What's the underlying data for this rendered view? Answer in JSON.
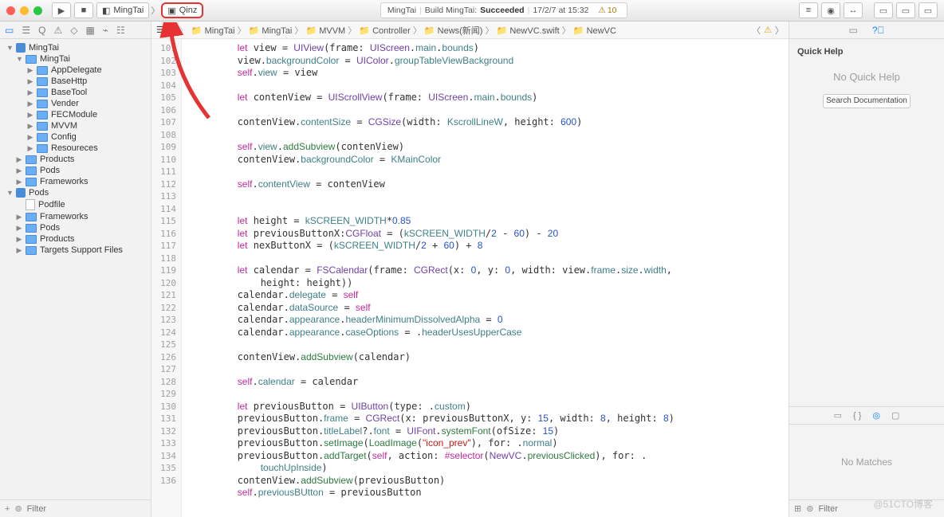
{
  "toolbar": {
    "scheme_app": "MingTai",
    "scheme_device": "Qinz",
    "status_prefix": "MingTai",
    "status_text": "Build MingTai:",
    "status_result": "Succeeded",
    "status_time": "17/2/7 at 15:32",
    "warn_count": "10"
  },
  "navigator": {
    "tree": [
      {
        "ind": 8,
        "tri": "▼",
        "icon": "proj",
        "label": "MingTai"
      },
      {
        "ind": 20,
        "tri": "▼",
        "icon": "fld",
        "label": "MingTai"
      },
      {
        "ind": 34,
        "tri": "▶",
        "icon": "fld",
        "label": "AppDelegate"
      },
      {
        "ind": 34,
        "tri": "▶",
        "icon": "fld",
        "label": "BaseHttp"
      },
      {
        "ind": 34,
        "tri": "▶",
        "icon": "fld",
        "label": "BaseTool"
      },
      {
        "ind": 34,
        "tri": "▶",
        "icon": "fld",
        "label": "Vender"
      },
      {
        "ind": 34,
        "tri": "▶",
        "icon": "fld",
        "label": "FECModule"
      },
      {
        "ind": 34,
        "tri": "▶",
        "icon": "fld",
        "label": "MVVM"
      },
      {
        "ind": 34,
        "tri": "▶",
        "icon": "fld",
        "label": "Config"
      },
      {
        "ind": 34,
        "tri": "▶",
        "icon": "fld",
        "label": "Resoureces"
      },
      {
        "ind": 20,
        "tri": "▶",
        "icon": "fld",
        "label": "Products"
      },
      {
        "ind": 20,
        "tri": "▶",
        "icon": "fld",
        "label": "Pods"
      },
      {
        "ind": 20,
        "tri": "▶",
        "icon": "fld",
        "label": "Frameworks"
      },
      {
        "ind": 8,
        "tri": "▼",
        "icon": "proj",
        "label": "Pods"
      },
      {
        "ind": 20,
        "tri": "",
        "icon": "file",
        "label": "Podfile"
      },
      {
        "ind": 20,
        "tri": "▶",
        "icon": "fld",
        "label": "Frameworks"
      },
      {
        "ind": 20,
        "tri": "▶",
        "icon": "fld",
        "label": "Pods"
      },
      {
        "ind": 20,
        "tri": "▶",
        "icon": "fld",
        "label": "Products"
      },
      {
        "ind": 20,
        "tri": "▶",
        "icon": "fld",
        "label": "Targets Support Files"
      }
    ],
    "filter_placeholder": "Filter"
  },
  "jumpbar": {
    "crumbs": [
      "MingTai",
      "MingTai",
      "MVVM",
      "Controller",
      "News(新闻)",
      "NewVC.swift",
      "NewVC"
    ]
  },
  "gutter_start": 101,
  "gutter_end": 136,
  "code_lines": [
    {
      "t": "        <kw>let</kw> view = <typ>UIView</typ>(frame: <typ>UIScreen</typ>.<prop>main</prop>.<prop>bounds</prop>)"
    },
    {
      "t": "        view.<prop>backgroundColor</prop> = <typ>UIColor</typ>.<prop>groupTableViewBackground</prop>"
    },
    {
      "t": "        <kw>self</kw>.<prop>view</prop> = view"
    },
    {
      "t": "        "
    },
    {
      "t": "        <kw>let</kw> contenView = <typ>UIScrollView</typ>(frame: <typ>UIScreen</typ>.<prop>main</prop>.<prop>bounds</prop>)"
    },
    {
      "t": "        "
    },
    {
      "t": "        contenView.<prop>contentSize</prop> = <typ>CGSize</typ>(width: <prop>KscrollLineW</prop>, height: <num>600</num>)"
    },
    {
      "t": "        "
    },
    {
      "t": "        <kw>self</kw>.<prop>view</prop>.<func>addSubview</func>(contenView)"
    },
    {
      "t": "        contenView.<prop>backgroundColor</prop> = <prop>KMainColor</prop>"
    },
    {
      "t": "        "
    },
    {
      "t": "        <kw>self</kw>.<prop>contentView</prop> = contenView"
    },
    {
      "t": "        "
    },
    {
      "t": "        "
    },
    {
      "t": "        <kw>let</kw> height = <prop>kSCREEN_WIDTH</prop>*<num>0.85</num>"
    },
    {
      "t": "        <kw>let</kw> previousButtonX:<typ>CGFloat</typ> = (<prop>kSCREEN_WIDTH</prop>/<num>2</num> - <num>60</num>) - <num>20</num>"
    },
    {
      "t": "        <kw>let</kw> nexButtonX = (<prop>kSCREEN_WIDTH</prop>/<num>2</num> + <num>60</num>) + <num>8</num>"
    },
    {
      "t": "        "
    },
    {
      "t": "        <kw>let</kw> calendar = <typ>FSCalendar</typ>(frame: <typ>CGRect</typ>(x: <num>0</num>, y: <num>0</num>, width: view.<prop>frame</prop>.<prop>size</prop>.<prop>width</prop>,\n            height: height))"
    },
    {
      "t": "        calendar.<prop>delegate</prop> = <kw>self</kw>"
    },
    {
      "t": "        calendar.<prop>dataSource</prop> = <kw>self</kw>"
    },
    {
      "t": "        calendar.<prop>appearance</prop>.<prop>headerMinimumDissolvedAlpha</prop> = <num>0</num>"
    },
    {
      "t": "        calendar.<prop>appearance</prop>.<prop>caseOptions</prop> = .<prop>headerUsesUpperCase</prop>"
    },
    {
      "t": "        "
    },
    {
      "t": "        contenView.<func>addSubview</func>(calendar)"
    },
    {
      "t": "        "
    },
    {
      "t": "        <kw>self</kw>.<prop>calendar</prop> = calendar"
    },
    {
      "t": "        "
    },
    {
      "t": "        <kw>let</kw> previousButton = <typ>UIButton</typ>(type: .<prop>custom</prop>)"
    },
    {
      "t": "        previousButton.<prop>frame</prop> = <typ>CGRect</typ>(x: previousButtonX, y: <num>15</num>, width: <num>8</num>, height: <num>8</num>)"
    },
    {
      "t": "        previousButton.<prop>titleLabel</prop>?.<prop>font</prop> = <typ>UIFont</typ>.<func>systemFont</func>(ofSize: <num>15</num>)"
    },
    {
      "t": "        previousButton.<func>setImage</func>(<func>LoadImage</func>(<str>\"icon_prev\"</str>), for: .<prop>normal</prop>)"
    },
    {
      "t": "        previousButton.<func>addTarget</func>(<kw>self</kw>, action: <kw>#selector</kw>(<typ>NewVC</typ>.<func>previousClicked</func>), for: .\n            <prop>touchUpInside</prop>)"
    },
    {
      "t": "        contenView.<func>addSubview</func>(previousButton)"
    },
    {
      "t": "        <kw>self</kw>.<prop>previousBUtton</prop> = previousButton"
    },
    {
      "t": "        "
    }
  ],
  "inspector": {
    "title": "Quick Help",
    "noqh": "No Quick Help",
    "search_doc": "Search Documentation",
    "nomatches": "No Matches",
    "filter_placeholder": "Filter"
  },
  "watermark": "@51CTO博客"
}
